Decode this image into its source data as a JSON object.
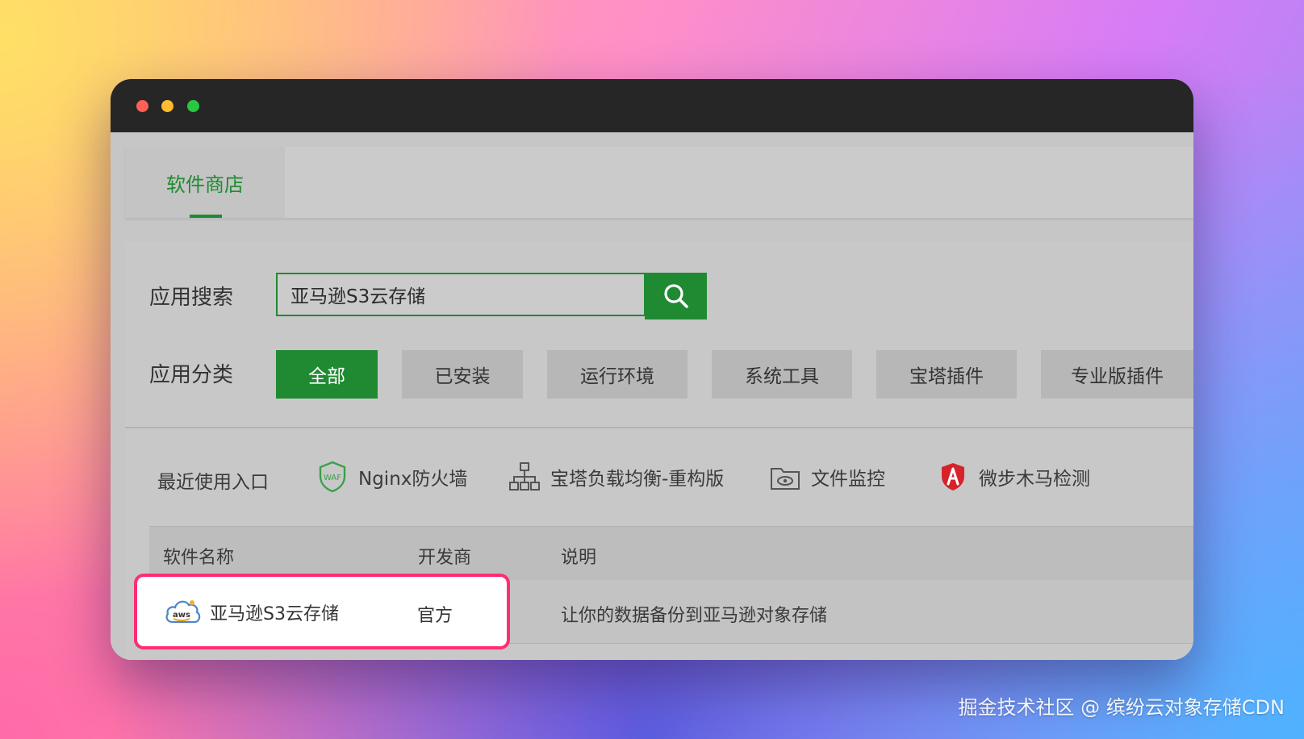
{
  "tabs": [
    {
      "label": "软件商店"
    }
  ],
  "search": {
    "label": "应用搜索",
    "value": "亚马逊S3云存储"
  },
  "categories": {
    "label": "应用分类",
    "items": [
      {
        "label": "全部",
        "active": true
      },
      {
        "label": "已安装"
      },
      {
        "label": "运行环境"
      },
      {
        "label": "系统工具"
      },
      {
        "label": "宝塔插件"
      },
      {
        "label": "专业版插件"
      }
    ]
  },
  "recent": {
    "label": "最近使用入口",
    "items": [
      {
        "label": "Nginx防火墙",
        "icon": "waf-shield-icon",
        "icon_text": "WAF"
      },
      {
        "label": "宝塔负载均衡-重构版",
        "icon": "network-icon"
      },
      {
        "label": "文件监控",
        "icon": "folder-eye-icon"
      },
      {
        "label": "微步木马检测",
        "icon": "red-shield-icon"
      }
    ]
  },
  "table": {
    "headers": [
      "软件名称",
      "开发商",
      "说明"
    ],
    "rows": [
      {
        "name": "亚马逊S3云存储",
        "vendor": "官方",
        "desc": "让你的数据备份到亚马逊对象存储",
        "icon": "aws-cloud-icon",
        "icon_text": "aws"
      }
    ]
  },
  "watermark": "掘金技术社区 @ 缤纷云对象存储CDN",
  "colors": {
    "accent": "#1f8a32",
    "highlight": "#ff2e74"
  }
}
